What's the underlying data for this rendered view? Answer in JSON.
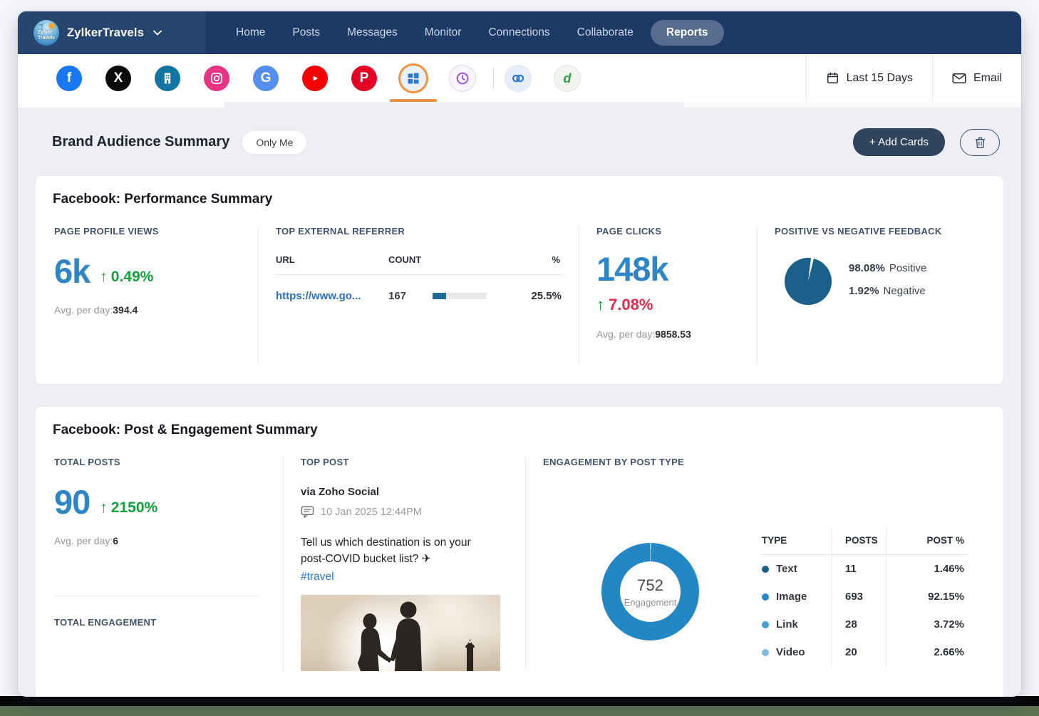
{
  "nav": {
    "brand": "ZylkerTravels",
    "logo_line1": "Zylker",
    "logo_line2": "Travels",
    "items": [
      "Home",
      "Posts",
      "Messages",
      "Monitor",
      "Connections",
      "Collaborate",
      "Reports"
    ],
    "active_item": "Reports"
  },
  "iconbar": {
    "networks": [
      "facebook",
      "x-twitter",
      "facebook-pages",
      "instagram",
      "google-business",
      "youtube",
      "pinterest",
      "brand-reports-selected",
      "zoho-pulse",
      "zoho-crm",
      "zoho-desk"
    ],
    "glyphs": {
      "facebook": "f",
      "x": "X",
      "google": "G",
      "pinterest": "P",
      "desk": "d"
    },
    "range_label": "Last 15 Days",
    "email_label": "Email"
  },
  "page": {
    "title": "Brand Audience Summary",
    "visibility_badge": "Only Me",
    "add_cards_label": "+ Add Cards"
  },
  "cards": {
    "performance": {
      "title": "Facebook: Performance Summary",
      "profile_views": {
        "label": "PAGE PROFILE VIEWS",
        "value": "6k",
        "arrow": "↑",
        "delta": "0.49%",
        "avg_label": "Avg. per day:",
        "avg_value": "394.4"
      },
      "referrer": {
        "label": "TOP EXTERNAL REFERRER",
        "headers": [
          "URL",
          "COUNT",
          "%"
        ],
        "row": {
          "url": "https://www.go...",
          "count": "167",
          "pct": "25.5%",
          "bar_pct": 25.5
        }
      },
      "clicks": {
        "label": "PAGE CLICKS",
        "value": "148k",
        "arrow": "↑",
        "delta": "7.08%",
        "avg_label": "Avg. per day:",
        "avg_value": "9858.53"
      },
      "feedback": {
        "label": "POSITIVE VS NEGATIVE FEEDBACK",
        "positive_value": "98.08%",
        "positive_label": "Positive",
        "negative_value": "1.92%",
        "negative_label": "Negative"
      }
    },
    "post_engagement": {
      "title": "Facebook: Post & Engagement Summary",
      "total_posts": {
        "label": "TOTAL POSTS",
        "value": "90",
        "arrow": "↑",
        "delta": "2150%",
        "avg_label": "Avg. per day:",
        "avg_value": "6"
      },
      "total_engagement_label": "TOTAL ENGAGEMENT",
      "top_post": {
        "label": "TOP POST",
        "via": "via Zoho Social",
        "date": "10 Jan 2025 12:44PM",
        "text": "Tell us which destination is on your post-COVID bucket list? ✈",
        "hashtag": "#travel"
      },
      "engagement_by_type": {
        "label": "ENGAGEMENT BY POST TYPE",
        "center_value": "752",
        "center_label": "Engagement",
        "headers": [
          "TYPE",
          "POSTS",
          "POST %"
        ],
        "rows": [
          {
            "type": "Text",
            "posts": "11",
            "pct": "1.46%",
            "color": "#1b5f87"
          },
          {
            "type": "Image",
            "posts": "693",
            "pct": "92.15%",
            "color": "#2487c5"
          },
          {
            "type": "Link",
            "posts": "28",
            "pct": "3.72%",
            "color": "#4a9bd5"
          },
          {
            "type": "Video",
            "posts": "20",
            "pct": "2.66%",
            "color": "#82bbe2"
          }
        ]
      }
    }
  },
  "chart_data": [
    {
      "id": "feedback_pie",
      "type": "pie",
      "title": "POSITIVE VS NEGATIVE FEEDBACK",
      "categories": [
        "Positive",
        "Negative"
      ],
      "values": [
        98.08,
        1.92
      ],
      "colors": [
        "#1b608a",
        "#ffffff"
      ],
      "legend_position": "right"
    },
    {
      "id": "engagement_donut",
      "type": "pie",
      "title": "ENGAGEMENT BY POST TYPE",
      "subtype": "donut",
      "categories": [
        "Text",
        "Image",
        "Link",
        "Video"
      ],
      "series": [
        {
          "name": "Posts",
          "values": [
            11,
            693,
            28,
            20
          ]
        },
        {
          "name": "Post %",
          "values": [
            1.46,
            92.15,
            3.72,
            2.66
          ]
        }
      ],
      "center_value": 752,
      "center_label": "Engagement",
      "colors": [
        "#1b5f87",
        "#2487c5",
        "#4a9bd5",
        "#82bbe2"
      ],
      "draw_order": [
        "Video",
        "Link",
        "Text",
        "Image"
      ]
    },
    {
      "id": "referrer_bar",
      "type": "bar",
      "title": "TOP EXTERNAL REFERRER",
      "categories": [
        "https://www.go..."
      ],
      "values": [
        25.5
      ],
      "counts": [
        167
      ],
      "xlim": [
        0,
        100
      ]
    }
  ],
  "colors": {
    "nav_bg": "#1d3a66",
    "accent_orange": "#f2923c",
    "metric_blue": "#2e86c6",
    "positive_green": "#13a13d",
    "negative_red": "#e9294b",
    "pie_blue": "#1b608a",
    "bar_fill": "#1d6a96",
    "add_cards_bg": "#30445e"
  }
}
